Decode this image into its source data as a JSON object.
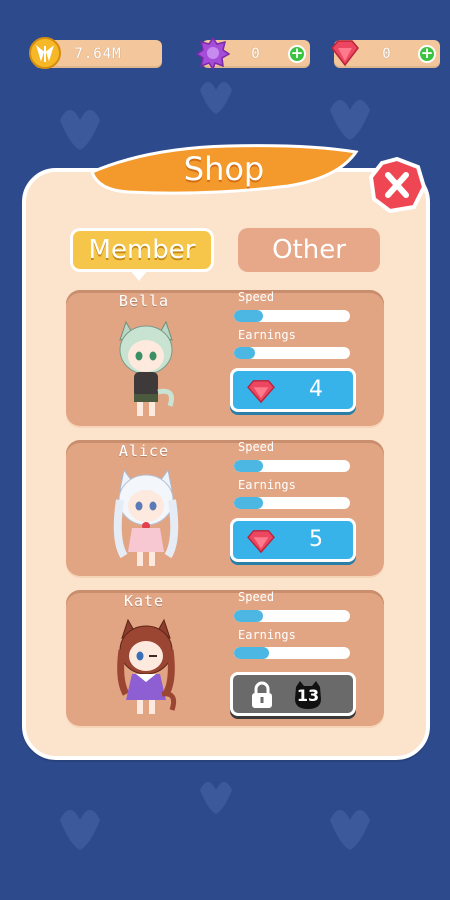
{
  "topbar": {
    "coins": "7.64M",
    "purple_gem": "0",
    "red_gem": "0"
  },
  "shop": {
    "title": "Shop",
    "tabs": [
      {
        "label": "Member",
        "selected": true
      },
      {
        "label": "Other",
        "selected": false
      }
    ],
    "speed_label": "Speed",
    "earnings_label": "Earnings",
    "members": [
      {
        "name": "Bella",
        "speed": 0.25,
        "earnings": 0.18,
        "price": "4",
        "locked": false
      },
      {
        "name": "Alice",
        "speed": 0.25,
        "earnings": 0.25,
        "price": "5",
        "locked": false
      },
      {
        "name": "Kate",
        "speed": 0.25,
        "earnings": 0.3,
        "unlock_level": "13",
        "locked": true
      }
    ]
  },
  "colors": {
    "background": "#2c4a8c",
    "panel": "#fbe3cc",
    "ribbon": "#f49a2c",
    "close": "#ee4753",
    "buy_button": "#37b3ea",
    "locked_button": "#6a6a6a",
    "bar_fill": "#4cb7e3"
  },
  "icons": [
    "coin-icon",
    "purple-gem-icon",
    "red-gem-icon",
    "plus-icon",
    "close-icon",
    "lock-icon",
    "cat-silhouette-icon"
  ]
}
